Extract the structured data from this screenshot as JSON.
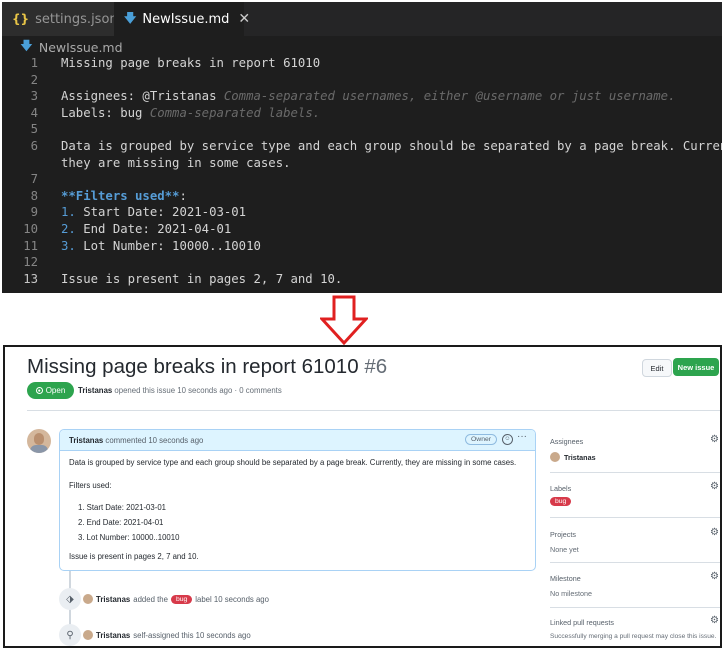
{
  "editor": {
    "tabs": [
      {
        "icon": "{}",
        "label": "settings.json"
      },
      {
        "icon": "md-file-icon",
        "label": "NewIssue.md",
        "close": "✕"
      }
    ],
    "breadcrumb": "NewIssue.md",
    "lines": [
      {
        "n": "1",
        "text": "Missing page breaks in report 61010"
      },
      {
        "n": "2",
        "text": ""
      },
      {
        "n": "3",
        "a": "Assignees: @Tristanas ",
        "hint": "Comma-separated usernames, either @username or just username."
      },
      {
        "n": "4",
        "a": "Labels: bug ",
        "hint": "Comma-separated labels."
      },
      {
        "n": "5",
        "text": ""
      },
      {
        "n": "6",
        "text": "Data is grouped by service type and each group should be separated by a page break. Currently,"
      },
      {
        "n": "",
        "text": "they are missing in some cases."
      },
      {
        "n": "7",
        "text": ""
      },
      {
        "n": "8",
        "bold": "**Filters used**",
        "rest": ":"
      },
      {
        "n": "9",
        "num": "1.",
        "rest": " Start Date: 2021-03-01"
      },
      {
        "n": "10",
        "num": "2.",
        "rest": " End Date: 2021-04-01"
      },
      {
        "n": "11",
        "num": "3.",
        "rest": " Lot Number: 10000..10010"
      },
      {
        "n": "12",
        "text": ""
      },
      {
        "n": "13",
        "text": "Issue is present in pages 2, 7 and 10."
      }
    ]
  },
  "issue": {
    "title": "Missing page breaks in report 61010",
    "number": "#6",
    "edit": "Edit",
    "new_issue": "New issue",
    "status": "Open",
    "author": "Tristanas",
    "opened": "opened this issue 10 seconds ago · 0 comments",
    "comment": {
      "author": "Tristanas",
      "when": "commented 10 seconds ago",
      "badge": "Owner",
      "para": "Data is grouped by service type and each group should be separated by a page break. Currently, they are missing in some cases.",
      "filters_heading": "Filters used:",
      "filters": [
        "1. Start Date: 2021-03-01",
        "2. End Date: 2021-04-01",
        "3. Lot Number: 10000..10010"
      ],
      "footer": "Issue is present in pages 2, 7 and 10."
    },
    "events": [
      {
        "author": "Tristanas",
        "pre": "added the",
        "label": "bug",
        "post": "label 10 seconds ago"
      },
      {
        "author": "Tristanas",
        "pre": "self-assigned this 10 seconds ago"
      }
    ],
    "sidebar": {
      "assignees_title": "Assignees",
      "assignee": "Tristanas",
      "labels_title": "Labels",
      "label": "bug",
      "projects_title": "Projects",
      "projects_val": "None yet",
      "milestone_title": "Milestone",
      "milestone_val": "No milestone",
      "linked_title": "Linked pull requests",
      "linked_val": "Successfully merging a pull request may close this issue."
    }
  },
  "colors": {
    "open_green": "#2da44e",
    "bug_red": "#d73a4a",
    "arrow_red": "#e02020"
  }
}
